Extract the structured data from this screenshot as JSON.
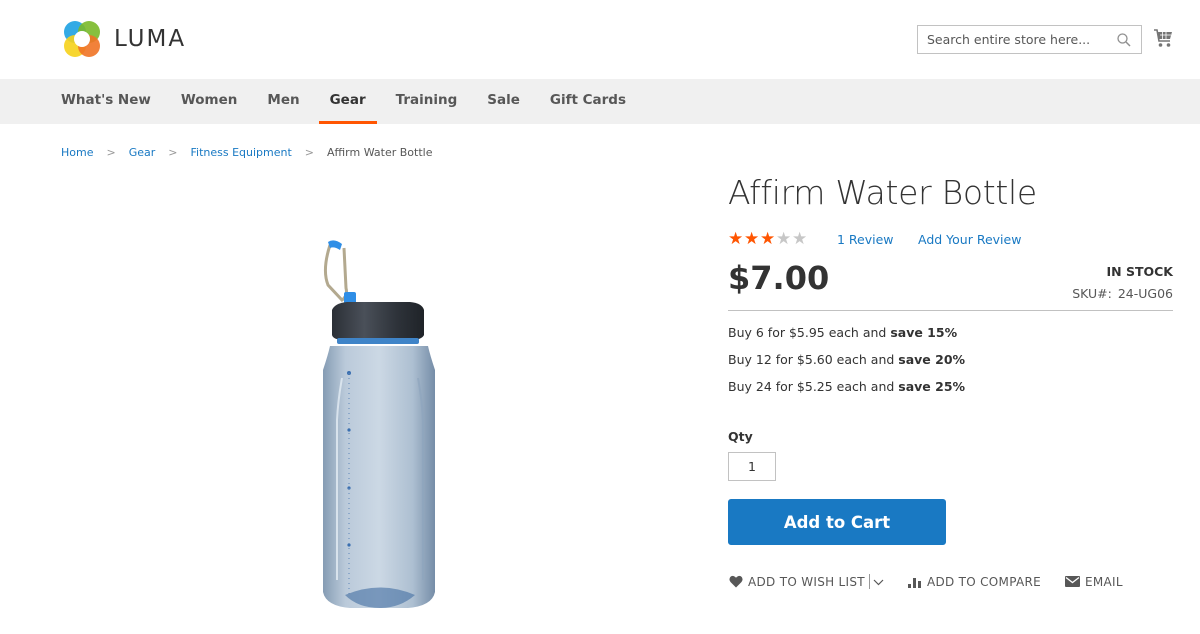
{
  "header": {
    "logo_text": "LUMA",
    "search": {
      "placeholder": "Search entire store here...",
      "value": ""
    },
    "cart_icon": "cart-icon"
  },
  "nav": {
    "items": [
      {
        "label": "What's New",
        "active": false
      },
      {
        "label": "Women",
        "active": false
      },
      {
        "label": "Men",
        "active": false
      },
      {
        "label": "Gear",
        "active": true
      },
      {
        "label": "Training",
        "active": false
      },
      {
        "label": "Sale",
        "active": false
      },
      {
        "label": "Gift Cards",
        "active": false
      }
    ],
    "active_color": "#ff5501"
  },
  "breadcrumb": {
    "items": [
      "Home",
      "Gear",
      "Fitness Equipment"
    ],
    "current": "Affirm Water Bottle",
    "separator": ">"
  },
  "product": {
    "name": "Affirm Water Bottle",
    "rating": {
      "stars": 3,
      "max": 5
    },
    "reviews_link": "1 Review",
    "add_review_link": "Add Your Review",
    "price": "$7.00",
    "stock_status": "IN STOCK",
    "sku_label": "SKU#:",
    "sku": "24-UG06",
    "tier_prices": [
      {
        "prefix": "Buy 6 for $5.95 each and ",
        "save": "save 15%"
      },
      {
        "prefix": "Buy 12 for $5.60 each and ",
        "save": "save 20%"
      },
      {
        "prefix": "Buy 24 for $5.25 each and ",
        "save": "save 25%"
      }
    ],
    "qty_label": "Qty",
    "qty_value": "1",
    "add_to_cart_label": "Add to Cart",
    "actions": {
      "wishlist": "ADD TO WISH LIST",
      "compare": "ADD TO COMPARE",
      "email": "EMAIL"
    }
  },
  "colors": {
    "link": "#1979c3",
    "button": "#1979c3",
    "star_on": "#ff5501",
    "star_off": "#c7c7c7"
  }
}
